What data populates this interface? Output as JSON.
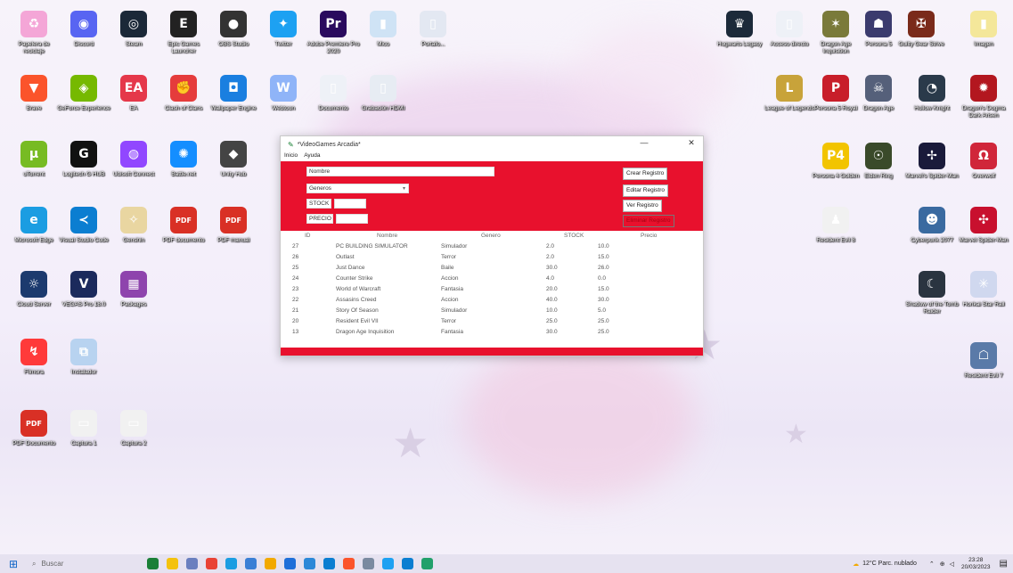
{
  "desktop_left": [
    {
      "label": "Papelera de reciclaje",
      "color": "#f4a6d7",
      "glyph": "♻",
      "icon": "recycle-bin-icon"
    },
    {
      "label": "Discord",
      "color": "#5865f2",
      "glyph": "◉",
      "icon": "discord-icon"
    },
    {
      "label": "Steam",
      "color": "#1b2838",
      "glyph": "◎",
      "icon": "steam-icon"
    },
    {
      "label": "Epic Games Launcher",
      "color": "#222",
      "glyph": "E",
      "icon": "epic-games-icon"
    },
    {
      "label": "OBS Studio",
      "color": "#333",
      "glyph": "●",
      "icon": "obs-icon"
    },
    {
      "label": "Twitter",
      "color": "#1da1f2",
      "glyph": "✦",
      "icon": "twitter-icon"
    },
    {
      "label": "Adobe Premiere Pro 2020",
      "color": "#2a0a5e",
      "glyph": "Pr",
      "icon": "premiere-icon"
    },
    {
      "label": "Mico",
      "color": "#cfe3f5",
      "glyph": "▮",
      "icon": "file-icon"
    },
    {
      "label": "Portafo...",
      "color": "#e3e8f2",
      "glyph": "▯",
      "icon": "file-icon"
    },
    {
      "label": "Brave",
      "color": "#fb542b",
      "glyph": "▼",
      "icon": "brave-icon"
    },
    {
      "label": "GeForce Experience",
      "color": "#76b900",
      "glyph": "◈",
      "icon": "geforce-icon"
    },
    {
      "label": "EA",
      "color": "#e5384a",
      "glyph": "EA",
      "icon": "ea-icon"
    },
    {
      "label": "Clash of Clans",
      "color": "#e53c3c",
      "glyph": "✊",
      "icon": "game-icon"
    },
    {
      "label": "Wallpaper Engine",
      "color": "#1a7fe0",
      "glyph": "◘",
      "icon": "wallpaper-engine-icon"
    },
    {
      "label": "Webtoon",
      "color": "#8fb4f8",
      "glyph": "W",
      "icon": "webtoon-icon"
    },
    {
      "label": "Documento",
      "color": "#eef1f7",
      "glyph": "▯",
      "icon": "file-icon"
    },
    {
      "label": "Grabación HDMI",
      "color": "#e7ecf3",
      "glyph": "▯",
      "icon": "file-icon"
    },
    {
      "label": "uTorrent",
      "color": "#77bb23",
      "glyph": "μ",
      "icon": "utorrent-icon"
    },
    {
      "label": "Logitech G HUB",
      "color": "#111",
      "glyph": "G",
      "icon": "logitech-icon"
    },
    {
      "label": "Ubisoft Connect",
      "color": "#9147ff",
      "glyph": "◍",
      "icon": "ubisoft-icon"
    },
    {
      "label": "Battle.net",
      "color": "#148eff",
      "glyph": "✺",
      "icon": "battlenet-icon"
    },
    {
      "label": "Unity Hub",
      "color": "#444",
      "glyph": "◆",
      "icon": "unity-icon"
    },
    {
      "label": "Microsoft Edge",
      "color": "#1b9de2",
      "glyph": "e",
      "icon": "edge-icon"
    },
    {
      "label": "Visual Studio Code",
      "color": "#0b7ed1",
      "glyph": "≺",
      "icon": "vscode-icon"
    },
    {
      "label": "Genshin",
      "color": "#e9d6a1",
      "glyph": "✧",
      "icon": "genshin-icon"
    },
    {
      "label": "PDF documento",
      "color": "#d93025",
      "glyph": "PDF",
      "icon": "pdf-icon"
    },
    {
      "label": "PDF manual",
      "color": "#d93025",
      "glyph": "PDF",
      "icon": "pdf-icon"
    },
    {
      "label": "Cloud Server",
      "color": "#1c3a6e",
      "glyph": "☼",
      "icon": "cloud-icon"
    },
    {
      "label": "VEGAS Pro 18.0",
      "color": "#1b2a5c",
      "glyph": "V",
      "icon": "vegas-icon"
    },
    {
      "label": "Packages",
      "color": "#8e44ad",
      "glyph": "▦",
      "icon": "winrar-icon"
    },
    {
      "label": "Filmora",
      "color": "#ff3a3a",
      "glyph": "↯",
      "icon": "app-icon"
    },
    {
      "label": "Instalador",
      "color": "#b8d3f0",
      "glyph": "⧉",
      "icon": "installer-icon"
    },
    {
      "label": "PDF Documento",
      "color": "#d93025",
      "glyph": "PDF",
      "icon": "pdf-icon"
    },
    {
      "label": "Captura 1",
      "color": "#f1f1f1",
      "glyph": "▭",
      "icon": "image-icon"
    },
    {
      "label": "Captura 2",
      "color": "#f1f1f1",
      "glyph": "▭",
      "icon": "image-icon"
    }
  ],
  "desktop_right": [
    {
      "label": "Hogwarts Legacy",
      "color": "#1c2a3a",
      "glyph": "♛",
      "icon": "game-icon"
    },
    {
      "label": "Acceso directo",
      "color": "#eef1f7",
      "glyph": "▯",
      "icon": "file-icon"
    },
    {
      "label": "Dragon Age Inquisition",
      "color": "#7a7a3a",
      "glyph": "✶",
      "icon": "game-icon"
    },
    {
      "label": "Persona 5",
      "color": "#3b3b6e",
      "glyph": "☗",
      "icon": "game-icon"
    },
    {
      "label": "Guilty Gear Strive",
      "color": "#7a2a1a",
      "glyph": "✠",
      "icon": "game-icon"
    },
    {
      "label": "Imagen",
      "color": "#f4e79a",
      "glyph": "▮",
      "icon": "file-icon"
    },
    {
      "label": "League of Legends",
      "color": "#c8a33a",
      "glyph": "L",
      "icon": "lol-icon"
    },
    {
      "label": "Persona 5 Royal",
      "color": "#c81e2a",
      "glyph": "P",
      "icon": "game-icon"
    },
    {
      "label": "Dragon Age",
      "color": "#55607a",
      "glyph": "☠",
      "icon": "game-icon"
    },
    {
      "label": "Hollow Knight",
      "color": "#2a3a4a",
      "glyph": "◔",
      "icon": "game-icon"
    },
    {
      "label": "Dragon's Dogma Dark Arisen",
      "color": "#b3171f",
      "glyph": "✹",
      "icon": "game-icon"
    },
    {
      "label": "Persona 4 Golden",
      "color": "#f2c400",
      "glyph": "P4",
      "icon": "game-icon"
    },
    {
      "label": "Elden Ring",
      "color": "#3a4a2a",
      "glyph": "☉",
      "icon": "game-icon"
    },
    {
      "label": "Marvel's Spider-Man",
      "color": "#1a1a3a",
      "glyph": "✢",
      "icon": "game-icon"
    },
    {
      "label": "Overwolf",
      "color": "#d0263a",
      "glyph": "Ω",
      "icon": "overwolf-icon"
    },
    {
      "label": "Resident Evil 8",
      "color": "#f1f1f1",
      "glyph": "♟",
      "icon": "game-icon"
    },
    {
      "label": "Cyberpunk 2077",
      "color": "#3a6aa0",
      "glyph": "☻",
      "icon": "game-icon"
    },
    {
      "label": "Marvel Spider-Man",
      "color": "#c8102e",
      "glyph": "✣",
      "icon": "game-icon"
    },
    {
      "label": "Shadow of the Tomb Raider",
      "color": "#2a3440",
      "glyph": "☾",
      "icon": "game-icon"
    },
    {
      "label": "Honkai Star Rail",
      "color": "#d0d8ef",
      "glyph": "✳",
      "icon": "game-icon"
    },
    {
      "label": "Resident Evil 7",
      "color": "#5a7aa8",
      "glyph": "☖",
      "icon": "game-icon"
    }
  ],
  "app": {
    "title": "*VideoGames Arcadia*",
    "menu": [
      "Inicio",
      "Ayuda"
    ],
    "form": {
      "nombre_label": "Nombre",
      "genero_placeholder": "Generos",
      "stock_label": "STOCK",
      "precio_label": "PRECIO"
    },
    "buttons": {
      "crear": "Crear Registro",
      "editar": "Editar Registro",
      "ver": "Ver Registro",
      "eliminar": "Eliminar Registro"
    },
    "table": {
      "headers": {
        "id": "ID",
        "nombre": "Nombre",
        "genero": "Genero",
        "stock": "STOCK",
        "precio": "Precio"
      },
      "rows": [
        {
          "id": "27",
          "nombre": "PC BUILDING SIMULATOR",
          "genero": "Simulador",
          "stock": "2.0",
          "precio": "10.0"
        },
        {
          "id": "26",
          "nombre": "Outlast",
          "genero": "Terror",
          "stock": "2.0",
          "precio": "15.0"
        },
        {
          "id": "25",
          "nombre": "Just Dance",
          "genero": "Baile",
          "stock": "30.0",
          "precio": "26.0"
        },
        {
          "id": "24",
          "nombre": "Counter Strike",
          "genero": "Accion",
          "stock": "4.0",
          "precio": "0.0"
        },
        {
          "id": "23",
          "nombre": "World of Warcraft",
          "genero": "Fantasia",
          "stock": "20.0",
          "precio": "15.0"
        },
        {
          "id": "22",
          "nombre": "Assasins Creed",
          "genero": "Accion",
          "stock": "40.0",
          "precio": "30.0"
        },
        {
          "id": "21",
          "nombre": "Story Of Season",
          "genero": "Simulador",
          "stock": "10.0",
          "precio": "5.0"
        },
        {
          "id": "20",
          "nombre": "Resident Evil VII",
          "genero": "Terror",
          "stock": "25.0",
          "precio": "25.0"
        },
        {
          "id": "13",
          "nombre": "Dragon Age Inquisition",
          "genero": "Fantasia",
          "stock": "30.0",
          "precio": "25.0"
        }
      ]
    }
  },
  "taskbar": {
    "search_placeholder": "Buscar",
    "weather": "12°C  Parc. nublado",
    "time": "23:28",
    "date": "20/03/2023",
    "apps": [
      "#1a7f37",
      "#f4c20d",
      "#6a7fbf",
      "#e94235",
      "#1b9de2",
      "#3a7fd5",
      "#f2a900",
      "#1e6fd9",
      "#2b88d8",
      "#0b7ed1",
      "#fb542b",
      "#7a8aa0",
      "#1da1f2",
      "#0b7ed1",
      "#22a06b"
    ]
  }
}
